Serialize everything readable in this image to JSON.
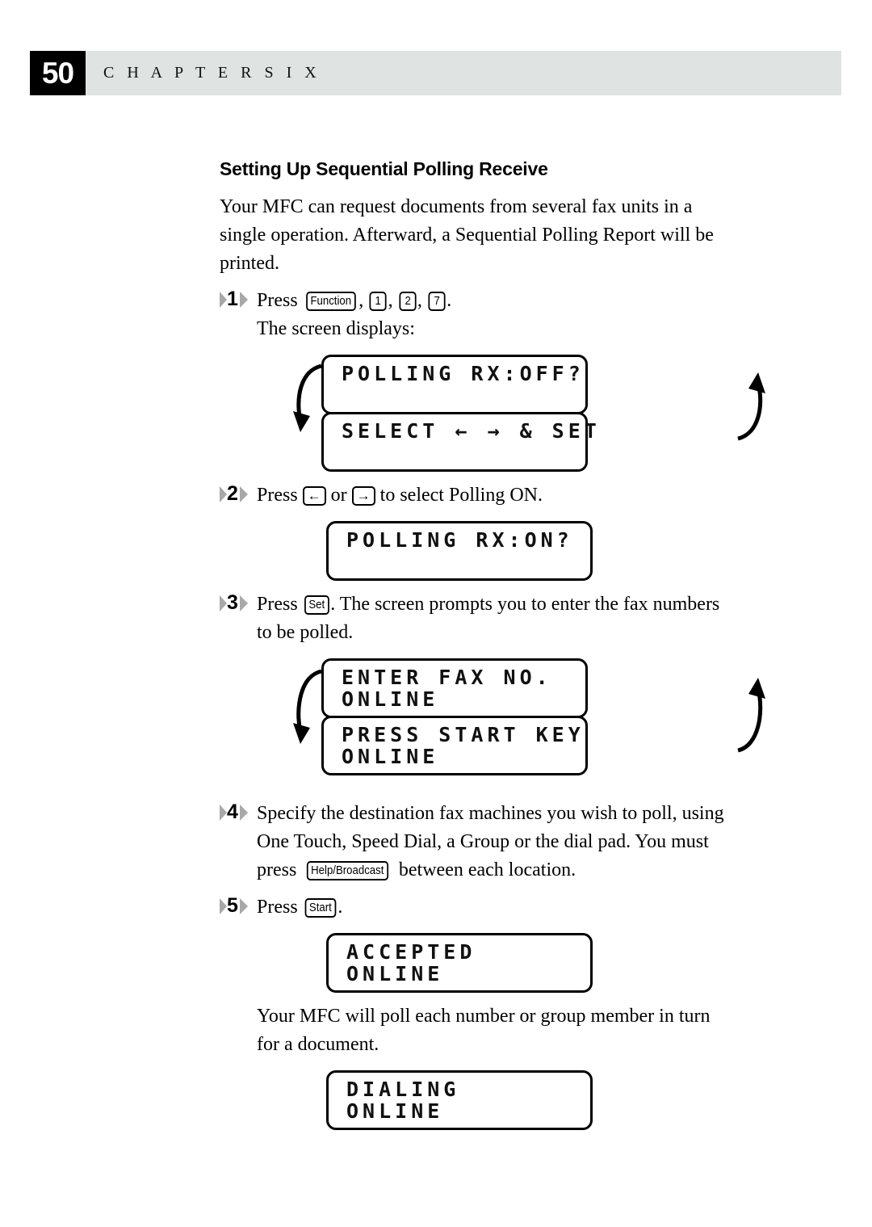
{
  "header": {
    "page_number": "50",
    "chapter": "C H A P T E R   S I X"
  },
  "section": {
    "title": "Setting Up Sequential Polling Receive",
    "intro": "Your MFC can request documents from several fax units in a single operation. Afterward, a Sequential Polling Report will be printed."
  },
  "steps": {
    "s1": {
      "number": "1",
      "press_label": "Press",
      "keys": [
        "Function",
        "1",
        "2",
        "7"
      ],
      "sep": ",",
      "period": ".",
      "follow": "The screen displays:"
    },
    "s2": {
      "number": "2",
      "text_before": "Press",
      "key_left": "←",
      "or_label": "or",
      "key_right": "→",
      "text_after": "to select Polling ON."
    },
    "s3": {
      "number": "3",
      "text_before": "Press",
      "key": "Set",
      "text_after": ". The screen prompts you to enter the fax numbers to be polled."
    },
    "s4": {
      "number": "4",
      "line1": "Specify the destination fax machines you wish to poll, using",
      "line2": "One Touch, Speed Dial, a Group or the dial pad. You must press",
      "key": "Help/Broadcast",
      "line3": "between each location."
    },
    "s5": {
      "number": "5",
      "text_before": "Press",
      "key": "Start",
      "text_after": "."
    }
  },
  "closing_text": "Your MFC will poll each number or group member in turn for a document.",
  "displays": {
    "d1": {
      "top": {
        "line1": "POLLING RX:OFF?",
        "line2": ""
      },
      "bottom": {
        "line1": "SELECT ← → & SET",
        "line2": ""
      },
      "cycles": true
    },
    "d2": {
      "top": {
        "line1": "POLLING RX:ON?",
        "line2": ""
      },
      "cycles": false
    },
    "d3": {
      "top": {
        "line1": "ENTER FAX NO.",
        "line2": "ONLINE"
      },
      "bottom": {
        "line1": "PRESS START KEY",
        "line2": "ONLINE"
      },
      "cycles": true
    },
    "d4": {
      "top": {
        "line1": "ACCEPTED",
        "line2": "ONLINE"
      },
      "cycles": false
    },
    "d5": {
      "top": {
        "line1": "DIALING",
        "line2": "ONLINE"
      },
      "cycles": false
    }
  },
  "colors": {
    "header_band": "#dfe3e2",
    "page_box": "#000000",
    "marker_wing": "#a8a8a8",
    "ink": "#000000",
    "paper": "#ffffff"
  }
}
